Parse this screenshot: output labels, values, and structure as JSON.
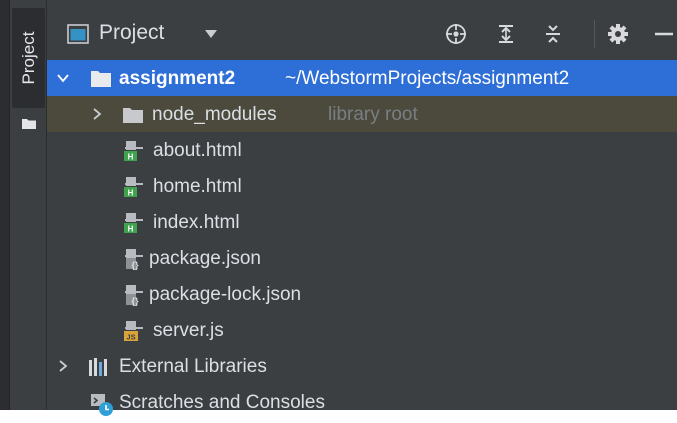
{
  "sidebar": {
    "tab_label": "Project"
  },
  "header": {
    "title": "Project",
    "icons": [
      "project-view-icon",
      "chevron-down-icon",
      "locate-icon",
      "expand-all-icon",
      "collapse-all-icon",
      "gear-icon",
      "minimize-icon"
    ]
  },
  "tree": {
    "root": {
      "name": "assignment2",
      "path": "~/WebstormProjects/assignment2"
    },
    "node_modules": {
      "name": "node_modules",
      "hint": "library root"
    },
    "files": [
      {
        "name": "about.html",
        "icon": "html-file-icon"
      },
      {
        "name": "home.html",
        "icon": "html-file-icon"
      },
      {
        "name": "index.html",
        "icon": "html-file-icon"
      },
      {
        "name": "package.json",
        "icon": "json-file-icon"
      },
      {
        "name": "package-lock.json",
        "icon": "json-file-icon"
      },
      {
        "name": "server.js",
        "icon": "js-file-icon"
      }
    ],
    "external_libraries": "External Libraries",
    "scratches": "Scratches and Consoles"
  },
  "colors": {
    "background": "#3b3f42",
    "selection": "#2e6ed7",
    "library_row": "#4b4a3d",
    "html_icon": "#3fa34d",
    "js_icon": "#d9a43a",
    "scratch_badge": "#2f9fd8"
  }
}
